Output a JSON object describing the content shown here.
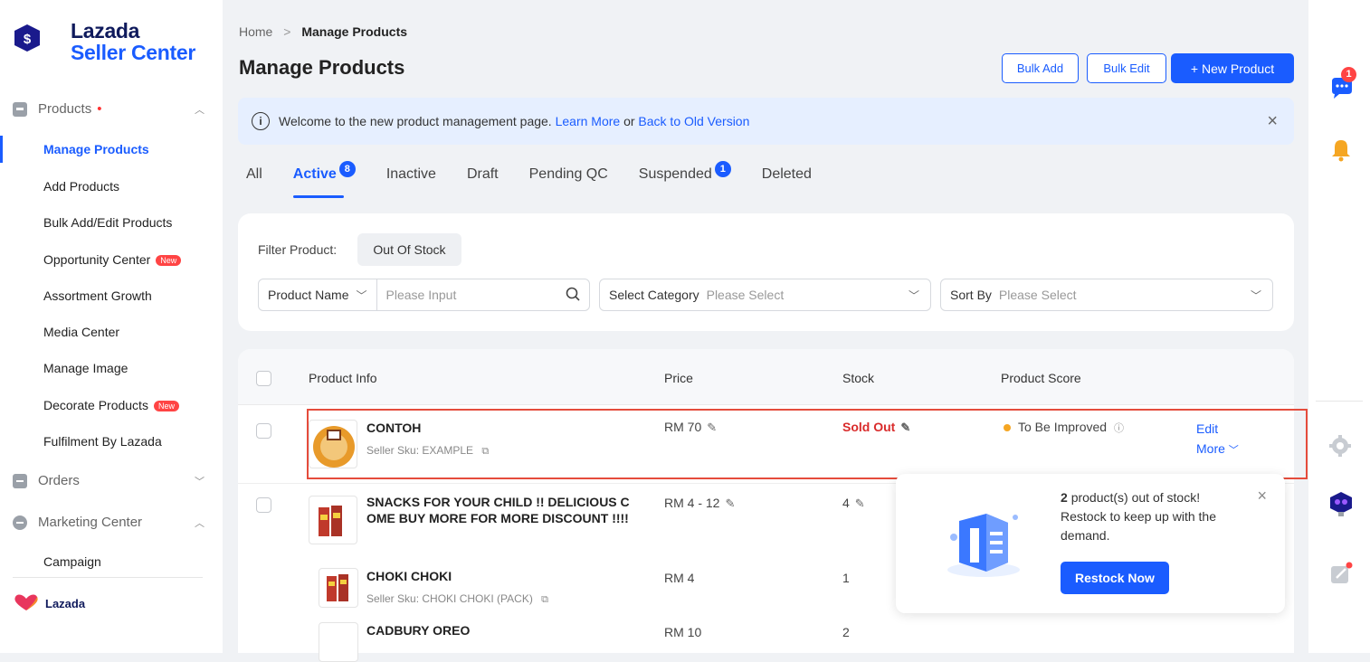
{
  "brand": {
    "line1": "Lazada",
    "line2": "Seller Center",
    "footer": "Lazada"
  },
  "sidebar": {
    "groups": [
      {
        "label": "Products",
        "dot": "•",
        "chevron": "^"
      },
      {
        "label": "Orders",
        "chevron": "v"
      },
      {
        "label": "Marketing Center",
        "chevron": "^"
      }
    ],
    "items": [
      {
        "label": "Manage Products"
      },
      {
        "label": "Add Products"
      },
      {
        "label": "Bulk Add/Edit Products"
      },
      {
        "label": "Opportunity Center",
        "badge": "New"
      },
      {
        "label": "Assortment Growth"
      },
      {
        "label": "Media Center"
      },
      {
        "label": "Manage Image"
      },
      {
        "label": "Decorate Products",
        "badge": "New"
      },
      {
        "label": "Fulfilment By Lazada"
      },
      {
        "label": "Campaign"
      }
    ]
  },
  "header": {
    "breadcrumb_home": "Home",
    "breadcrumb_sep": ">",
    "breadcrumb_current": "Manage Products",
    "title": "Manage Products",
    "bulk_add": "Bulk Add",
    "bulk_edit": "Bulk Edit",
    "new_product": "+ New Product"
  },
  "banner": {
    "text": "Welcome to the new product management page.",
    "learn_more": "Learn More",
    "or": "or",
    "back_link": "Back to Old Version",
    "info_glyph": "i",
    "close_glyph": "×"
  },
  "tabs": [
    {
      "label": "All"
    },
    {
      "label": "Active",
      "count": "8"
    },
    {
      "label": "Inactive"
    },
    {
      "label": "Draft"
    },
    {
      "label": "Pending QC"
    },
    {
      "label": "Suspended",
      "count": "1"
    },
    {
      "label": "Deleted"
    }
  ],
  "filters": {
    "label": "Filter Product:",
    "chip": "Out Of Stock",
    "product_name_label": "Product Name",
    "product_name_placeholder": "Please Input",
    "category_label": "Select Category",
    "category_placeholder": "Please Select",
    "sort_label": "Sort By",
    "sort_placeholder": "Please Select"
  },
  "table": {
    "columns": [
      "Product Info",
      "Price",
      "Stock",
      "Product Score"
    ],
    "rows": [
      {
        "name": "CONTOH",
        "sku": "Seller Sku: EXAMPLE",
        "price": "RM 70",
        "stock": "Sold Out",
        "score": "To Be Improved",
        "edit": "Edit",
        "more": "More"
      },
      {
        "name_line1": "SNACKS FOR YOUR CHILD !! DELICIOUS C",
        "name_line2": "OME BUY MORE FOR MORE DISCOUNT !!!!",
        "price": "RM 4 - 12",
        "stock": "4"
      },
      {
        "name": "CHOKI CHOKI",
        "sku": "Seller Sku: CHOKI CHOKI (PACK)",
        "price": "RM 4",
        "stock": "1"
      },
      {
        "name": "CADBURY OREO",
        "price": "RM 10",
        "stock": "2"
      }
    ]
  },
  "popup": {
    "count": "2",
    "message": "product(s) out of stock! Restock to keep up with the demand.",
    "button": "Restock Now",
    "close_glyph": "×"
  },
  "rightbar": {
    "chat_badge": "1"
  },
  "colors": {
    "accent": "#1a5cff",
    "danger": "#d92b2b",
    "warning": "#f5a623"
  }
}
